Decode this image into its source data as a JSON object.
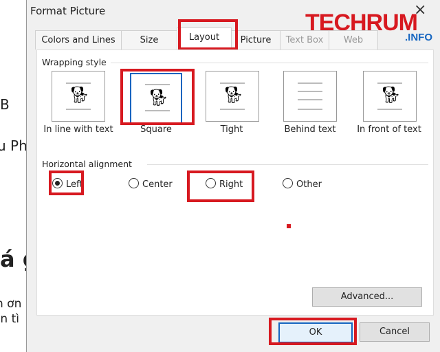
{
  "document": {
    "fragments": [
      "B",
      "u Ph",
      "á g",
      "n ơn l",
      "ạn tì"
    ]
  },
  "dialog": {
    "title": "Format Picture",
    "close": "×",
    "watermark": {
      "main": "TECHRUM",
      "sub": ".INFO"
    },
    "tabs": [
      {
        "label": "Colors and Lines"
      },
      {
        "label": "Size"
      },
      {
        "label": "Layout"
      },
      {
        "label": "Picture"
      },
      {
        "label": "Text Box"
      },
      {
        "label": "Web"
      }
    ],
    "wrapping_style": {
      "label": "Wrapping style",
      "options": [
        {
          "label": "In line with text"
        },
        {
          "label": "Square",
          "selected": true
        },
        {
          "label": "Tight"
        },
        {
          "label": "Behind text"
        },
        {
          "label": "In front of text"
        }
      ]
    },
    "horizontal_alignment": {
      "label": "Horizontal alignment",
      "options": [
        {
          "label": "Left",
          "selected": true
        },
        {
          "label": "Center"
        },
        {
          "label": "Right"
        },
        {
          "label": "Other"
        }
      ]
    },
    "advanced": "Advanced...",
    "ok": "OK",
    "cancel": "Cancel"
  },
  "colors": {
    "highlight": "#d71920",
    "selection": "#1565c0"
  }
}
